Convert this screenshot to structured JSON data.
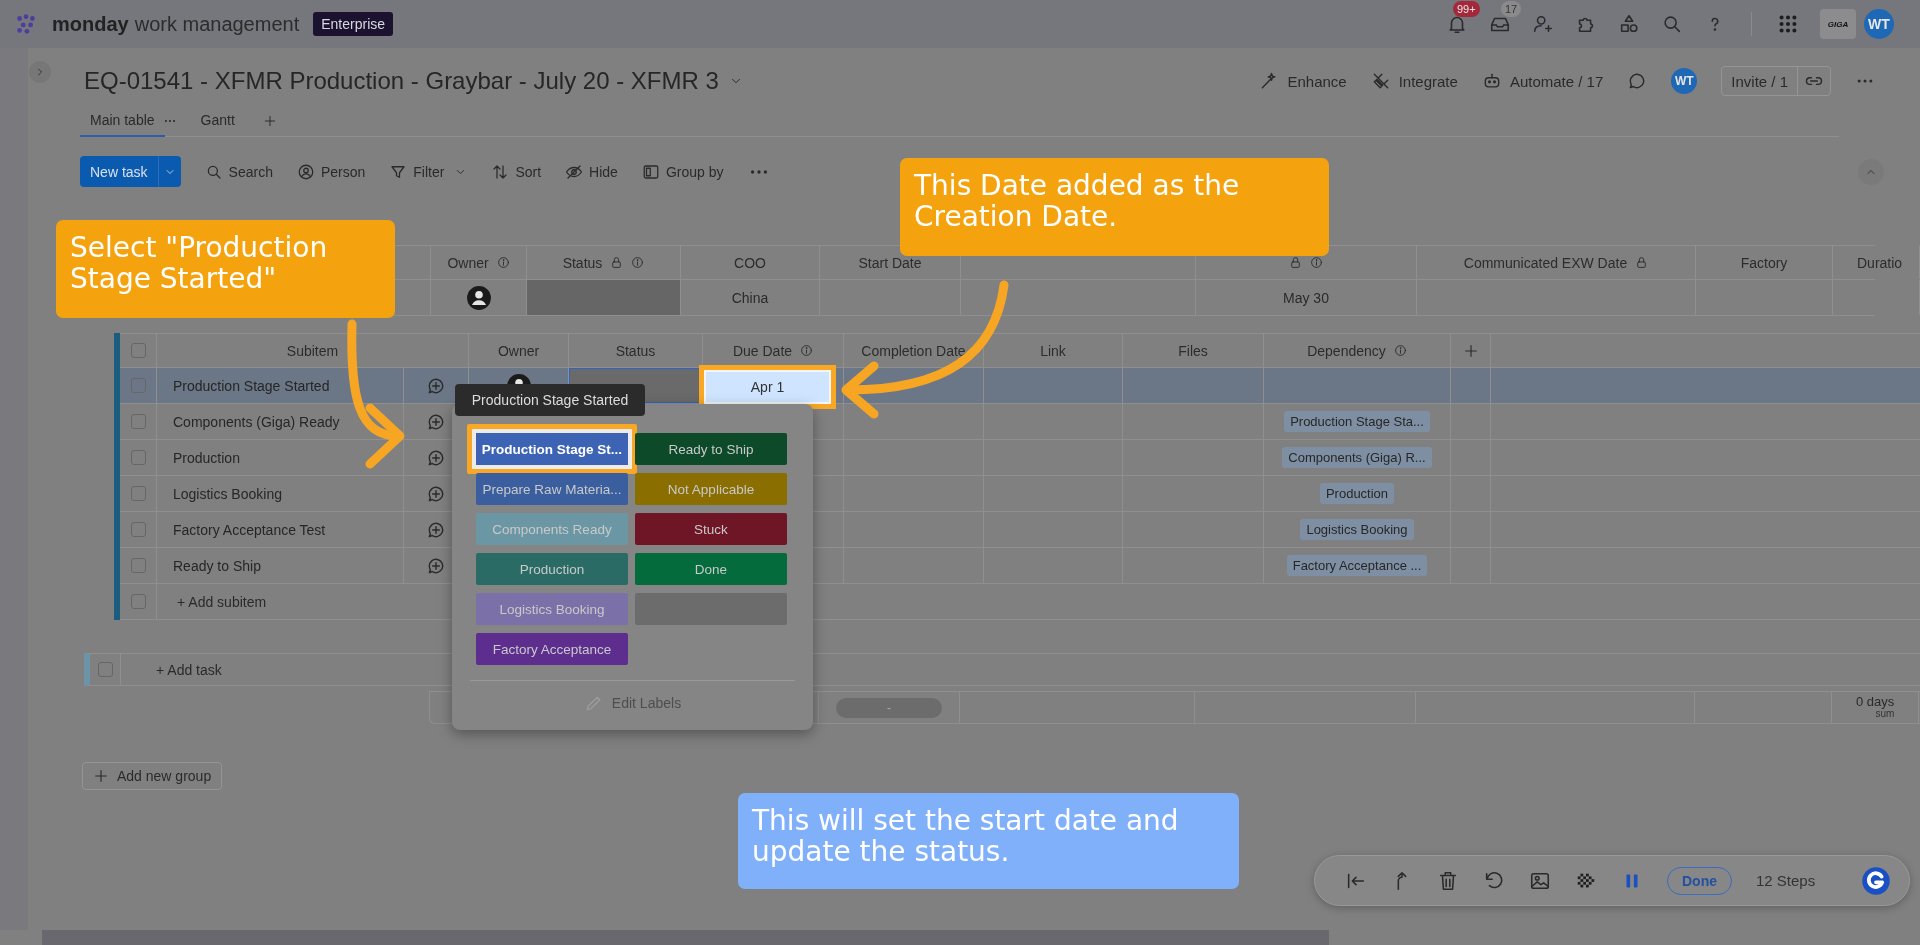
{
  "top_bar": {
    "brand": "monday",
    "product": "work management",
    "plan": "Enterprise",
    "notifications": "99+",
    "inbox": "17",
    "workspace_logo": "GIGA",
    "user": "WT"
  },
  "board": {
    "title": "EQ-01541 - XFMR Production - Graybar - July 20 - XFMR 3",
    "actions": [
      "Enhance",
      "Integrate",
      "Automate / 17"
    ],
    "member": "WT",
    "invite": "Invite / 1"
  },
  "views": [
    {
      "label": "Main table",
      "selected": true
    },
    {
      "label": "Gantt",
      "selected": false
    }
  ],
  "toolbar": {
    "new_task": "New task",
    "tools": [
      "Search",
      "Person",
      "Filter",
      "Sort",
      "Hide",
      "Group by"
    ]
  },
  "main_table": {
    "columns": [
      {
        "label": "Owner",
        "info": true,
        "kind": "person"
      },
      {
        "label": "Status",
        "info": true,
        "lock": true,
        "kind": "status"
      },
      {
        "label": "COO",
        "value": "China"
      },
      {
        "label": "Start Date",
        "summary": "-"
      },
      {
        "kind": "hidden"
      },
      {
        "info": true,
        "lock": true,
        "value": "May 30"
      },
      {
        "label": "Communicated EXW Date",
        "lock": true
      },
      {
        "label": "Factory"
      },
      {
        "label": "Duratio",
        "summary": "0 days",
        "summary_caption": "sum"
      }
    ]
  },
  "subitems": {
    "all_checked": false,
    "columns": [
      {
        "label": "Subitem"
      },
      {
        "label": "Owner"
      },
      {
        "label": "Status"
      },
      {
        "label": "Due Date",
        "info": true
      },
      {
        "label": "Completion Date"
      },
      {
        "label": "Link"
      },
      {
        "label": "Files"
      },
      {
        "label": "Dependency",
        "info": true
      }
    ],
    "rows": [
      {
        "name": "Production Stage Started",
        "selected": true,
        "checked": false,
        "owner": true,
        "status_focused": true,
        "due_date": {
          "text": "Apr 1",
          "highlighted": true
        }
      },
      {
        "name": "Components (Giga) Ready",
        "selected": false,
        "checked": false,
        "dependency": "Production Stage Sta..."
      },
      {
        "name": "Production",
        "selected": false,
        "checked": false,
        "dependency": "Components (Giga) R..."
      },
      {
        "name": "Logistics Booking",
        "selected": false,
        "checked": false,
        "dependency": "Production"
      },
      {
        "name": "Factory Acceptance Test",
        "selected": false,
        "checked": false,
        "dependency": "Logistics Booking"
      },
      {
        "name": "Ready to Ship",
        "selected": false,
        "checked": false,
        "dependency": "Factory Acceptance ..."
      }
    ],
    "add": "+ Add subitem",
    "add_checked": false
  },
  "add_task": "+ Add task",
  "add_task_checked": false,
  "add_group": "Add new group",
  "status_menu": {
    "tooltip": "Production Stage Started",
    "labels": [
      {
        "label": "Production Stage St...",
        "color": "#3d64b4",
        "selected": true
      },
      {
        "label": "Ready to Ship",
        "color": "#0c4a2a",
        "selected": false
      },
      {
        "label": "Prepare Raw Materia...",
        "color": "#3a5e9e",
        "selected": false
      },
      {
        "label": "Not Applicable",
        "color": "#8a6e00",
        "selected": false
      },
      {
        "label": "Components Ready",
        "color": "#6b97a5",
        "selected": false
      },
      {
        "label": "Stuck",
        "color": "#6e1625",
        "selected": false
      },
      {
        "label": "Production",
        "color": "#2a6b65",
        "selected": false
      },
      {
        "label": "Done",
        "color": "#036b3c",
        "selected": false
      },
      {
        "label": "Logistics Booking",
        "color": "#7c70a8",
        "selected": false
      },
      {
        "color": "#6c6c6c",
        "selected": false
      },
      {
        "label": "Factory Acceptance",
        "color": "#5e2e8e",
        "selected": false
      }
    ],
    "edit": "Edit Labels"
  },
  "callouts": [
    {
      "text": "Select \"Production Stage Started\"",
      "color": "#f5a20f"
    },
    {
      "text": "This Date added as the Creation Date.",
      "color": "#f5a20f"
    },
    {
      "text": "This will set the start date and update the status.",
      "color": "#80b0fa"
    }
  ],
  "player": {
    "done": "Done",
    "steps": "12 Steps"
  }
}
